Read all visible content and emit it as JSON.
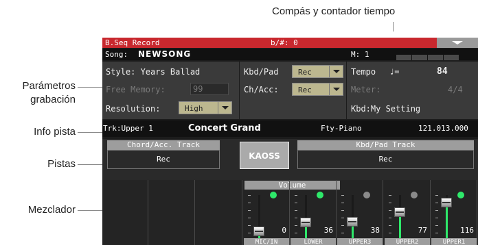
{
  "callouts": {
    "top": "Compás y contador tiempo",
    "record_params": "Parámetros\ngrabación",
    "track_info": "Info pista",
    "tracks": "Pistas",
    "mixer": "Mezclador"
  },
  "titlebar": {
    "title": "B.Seq Record",
    "key": "b/#: 0"
  },
  "song": {
    "label": "Song:",
    "name": "NEWSONG",
    "measure": "M: 1"
  },
  "params": {
    "style": "Style: Years Ballad",
    "free_memory_label": "Free Memory:",
    "free_memory_value": "99",
    "resolution_label": "Resolution:",
    "resolution_value": "High",
    "kbd_pad_label": "Kbd/Pad",
    "kbd_pad_value": "Rec",
    "ch_acc_label": "Ch/Acc:",
    "ch_acc_value": "Rec",
    "tempo_label": "Tempo",
    "tempo_note": "♩=",
    "tempo_value": "84",
    "meter_label": "Meter:",
    "meter_value": "4/4",
    "kbd_setting": "Kbd:My Setting"
  },
  "track_info": {
    "track": "Trk:Upper 1",
    "sound": "Concert Grand",
    "bank": "Fty-Piano",
    "number": "121.013.000"
  },
  "tracks": {
    "chord_label": "Chord/Acc. Track",
    "chord_value": "Rec",
    "kaoss_label": "KAOSS",
    "kbd_label": "Kbd/Pad Track",
    "kbd_value": "Rec"
  },
  "mixer": {
    "volume_label": "Volume",
    "channels": [
      {
        "name": "MIC/IN",
        "value": "0",
        "level": 0.0,
        "led": "green"
      },
      {
        "name": "LOWER",
        "value": "36",
        "level": 0.28,
        "led": "green"
      },
      {
        "name": "UPPER3",
        "value": "38",
        "level": 0.3,
        "led": "gray"
      },
      {
        "name": "UPPER2",
        "value": "77",
        "level": 0.61,
        "led": "gray"
      },
      {
        "name": "UPPER1",
        "value": "116",
        "level": 0.91,
        "led": "green"
      }
    ]
  },
  "colors": {
    "title_red": "#c8282e",
    "button_khaki": "#bcb78f",
    "led_green": "#2ee86a",
    "led_gray": "#8a8a8a",
    "fill_green": "#2ee86a"
  }
}
